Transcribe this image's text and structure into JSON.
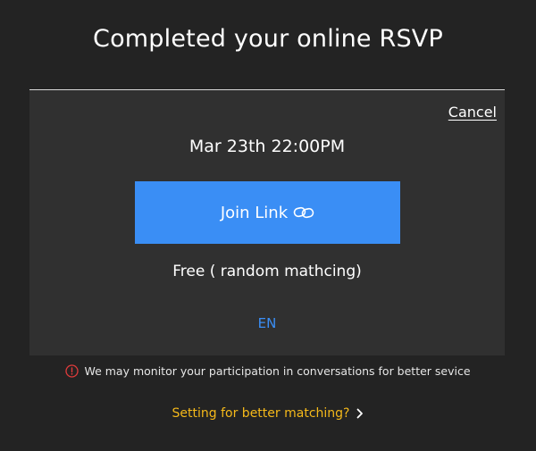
{
  "header": {
    "title": "Completed your online RSVP"
  },
  "card": {
    "cancel_label": "Cancel",
    "datetime": "Mar 23th 22:00PM",
    "join_label": "Join Link",
    "join_icon": "link-icon",
    "price_text": "Free ( random mathcing)",
    "language": "EN"
  },
  "footer": {
    "notice_icon": "alert-circle-icon",
    "notice_text": "We may monitor your participation in conversations for better sevice",
    "settings_link": "Setting for better matching?",
    "settings_icon": "chevron-right-icon"
  },
  "colors": {
    "background": "#232323",
    "card": "#303030",
    "accent": "#3a8ef5",
    "warning": "#f5b91a",
    "alert": "#e03b3b"
  }
}
